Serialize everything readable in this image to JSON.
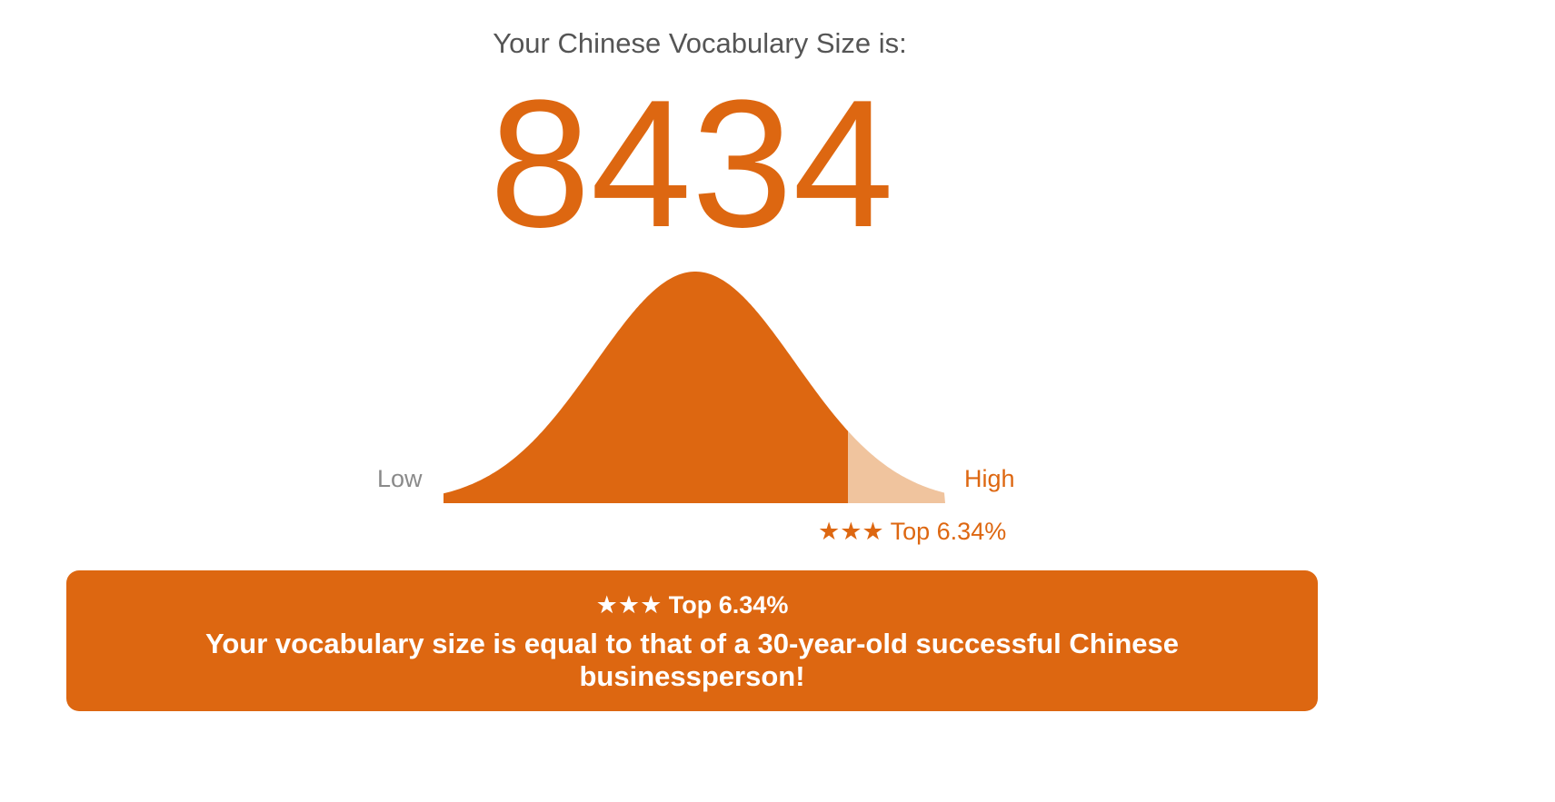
{
  "heading": "Your Chinese Vocabulary Size is:",
  "score": "8434",
  "distribution": {
    "low_label": "Low",
    "high_label": "High",
    "marker_text": "★★★ Top 6.34%",
    "top_percent": 6.34,
    "fill_color": "#dd6711",
    "tail_color": "#f0c49e"
  },
  "result": {
    "rank": "★★★ Top 6.34%",
    "message": "Your vocabulary size is equal to that of a 30-year-old successful Chinese businessperson!"
  },
  "colors": {
    "accent": "#dd6711",
    "heading": "#555555",
    "low_label": "#8a8a8a"
  }
}
